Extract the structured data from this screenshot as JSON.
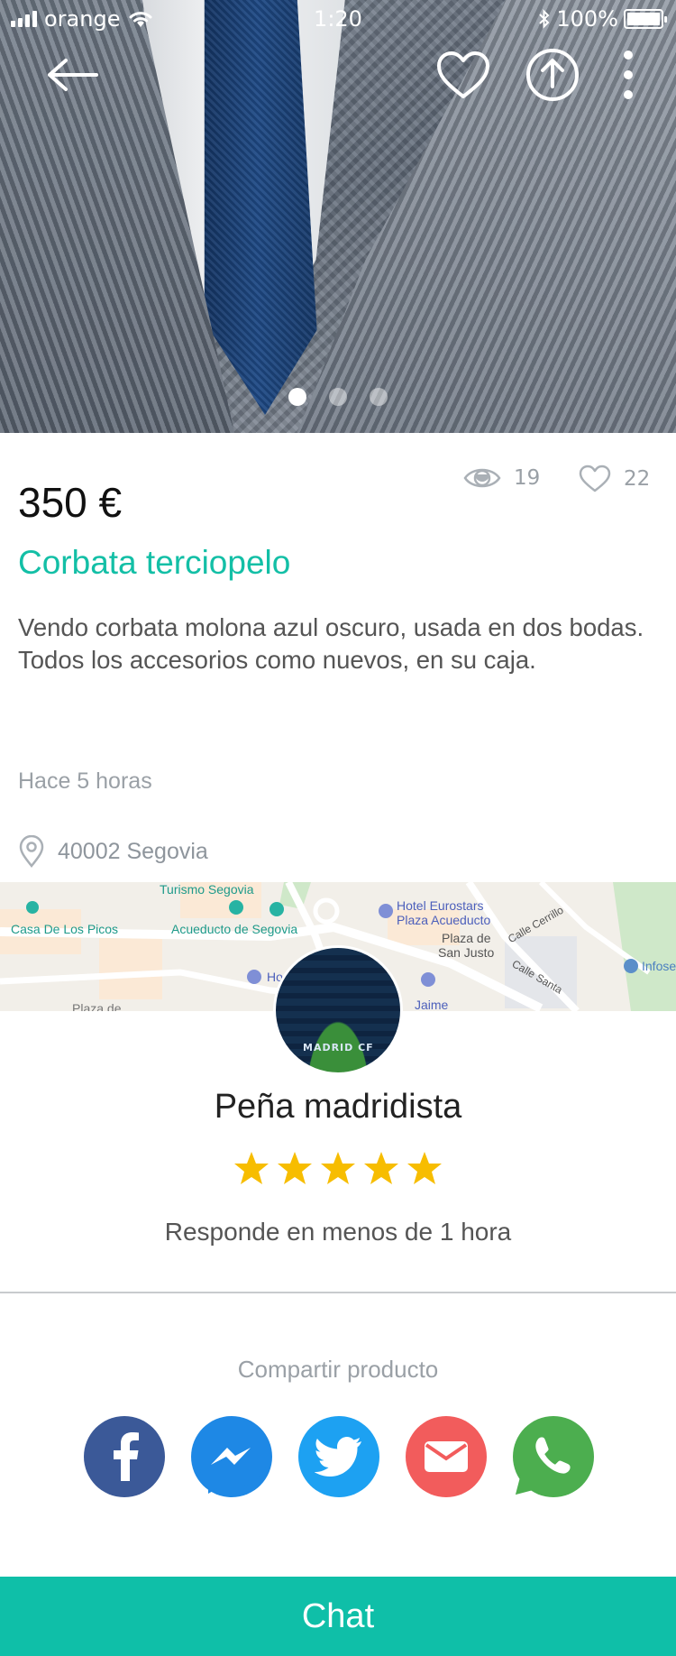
{
  "status_bar": {
    "carrier": "orange",
    "time": "1:20",
    "battery": "100%"
  },
  "hero": {
    "icons": [
      "back-arrow-icon",
      "heart-icon",
      "share-icon",
      "more-icon"
    ],
    "image_count": 3,
    "active_image": 1
  },
  "product": {
    "views": "19",
    "likes": "22",
    "price": "350 €",
    "title": "Corbata terciopelo",
    "description_line1": "Vendo corbata molona azul oscuro, usada en dos bodas.",
    "description_line2": "Todos los accesorios como nuevos, en su caja.",
    "time_ago": "Hace 5 horas",
    "location": "40002 Segovia"
  },
  "map": {
    "labels": {
      "turismo": "Turismo Segovia",
      "hotel": "Hotel Eurostars",
      "hotel2": "Plaza Acueducto",
      "casa": "Casa De Los Picos",
      "acueducto": "Acueducto de Segovia",
      "plaza": "Plaza de",
      "plaza2": "San Justo",
      "calle_cerrillo": "Calle Cerrillo",
      "calle_santa": "Calle Santa",
      "infose": "Infose",
      "jaime": "Jaime",
      "ho": "Ho",
      "plaza_de": "Plaza de"
    }
  },
  "seller": {
    "name": "Peña madridista",
    "rating": 5,
    "max_rating": 5,
    "response": "Responde en menos de 1 hora",
    "avatar_text": "MADRID CF"
  },
  "share": {
    "label": "Compartir producto",
    "buttons": [
      {
        "name": "facebook",
        "color": "#3b5998"
      },
      {
        "name": "messenger",
        "color": "#1e88e5"
      },
      {
        "name": "twitter",
        "color": "#1da1f2"
      },
      {
        "name": "email",
        "color": "#f25c5c"
      },
      {
        "name": "whatsapp",
        "color": "#4cae4f"
      }
    ]
  },
  "chat": {
    "label": "Chat"
  },
  "colors": {
    "accent": "#13bfa6",
    "chat_bar": "#0fbfa8",
    "star": "#f7bd00"
  }
}
